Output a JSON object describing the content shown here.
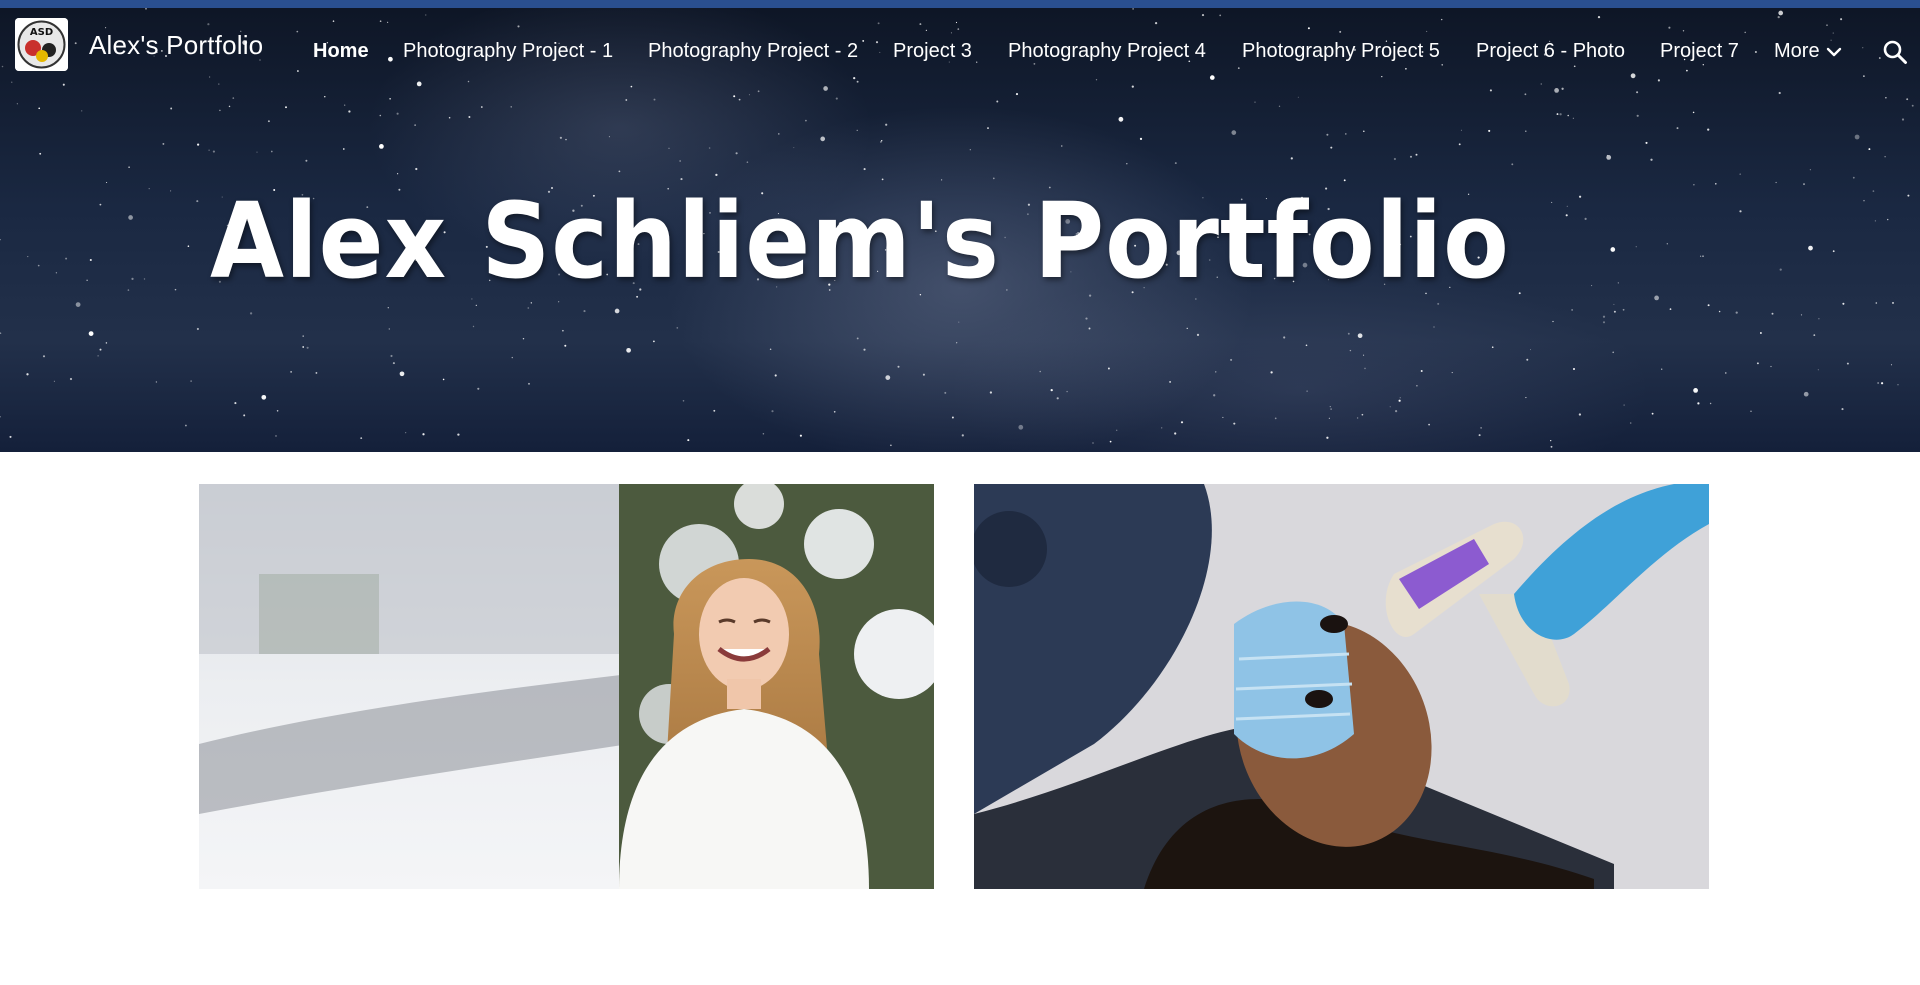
{
  "header": {
    "site_title": "Alex's Portfolio",
    "logo_text": "ASD"
  },
  "nav": {
    "items": [
      {
        "label": "Home",
        "active": true
      },
      {
        "label": "Photography Project - 1",
        "active": false
      },
      {
        "label": "Photography Project - 2",
        "active": false
      },
      {
        "label": "Project 3",
        "active": false
      },
      {
        "label": "Photography Project 4",
        "active": false
      },
      {
        "label": "Photography Project 5",
        "active": false
      },
      {
        "label": "Project 6 - Photo",
        "active": false
      },
      {
        "label": "Project 7",
        "active": false
      }
    ],
    "more_label": "More",
    "more_icon": "chevron-down-icon",
    "search_icon": "search-icon"
  },
  "hero": {
    "title": "Alex Schliem's Portfolio"
  },
  "gallery": {
    "images": [
      {
        "subject": "woman-in-snow-photo"
      },
      {
        "subject": "temperature-check-photo"
      }
    ]
  },
  "colors": {
    "top_stripe": "#2a4f8f",
    "hero_dark": "#0e1626",
    "hero_mid": "#1a2842",
    "nav_text": "#ffffff",
    "page_bg": "#ffffff"
  }
}
